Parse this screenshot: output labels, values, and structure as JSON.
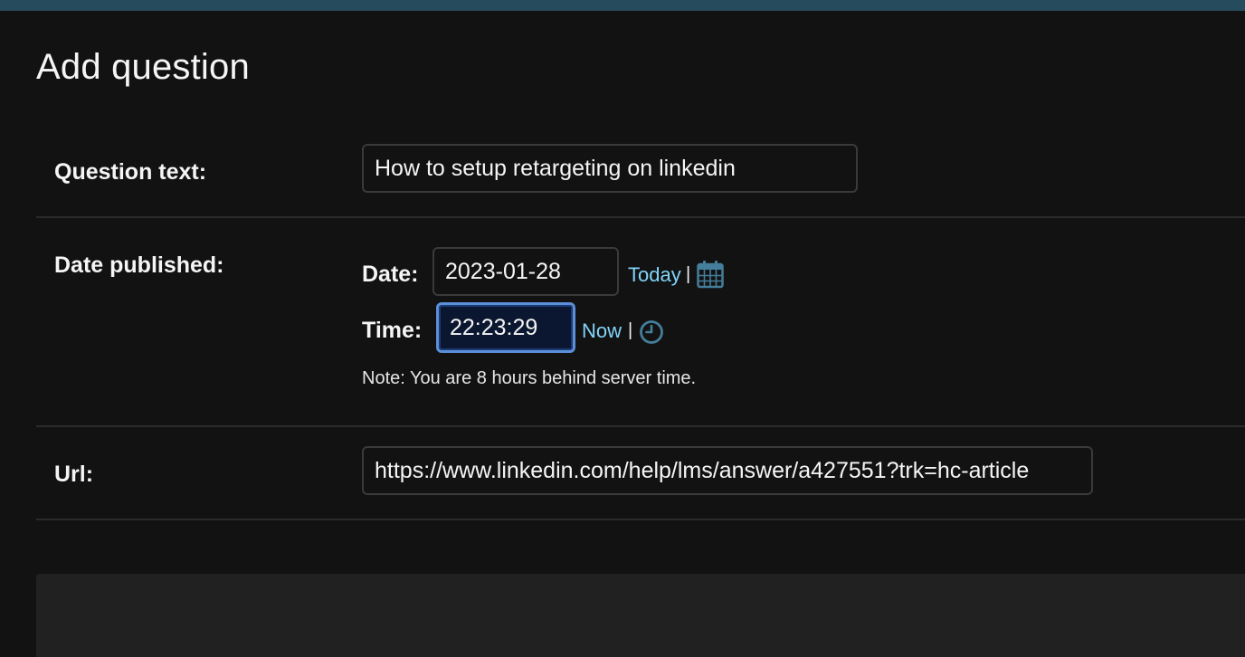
{
  "page": {
    "title": "Add question"
  },
  "fields": {
    "question_text": {
      "label": "Question text:",
      "value": "How to setup retargeting on linkedin"
    },
    "date_published": {
      "label": "Date published:",
      "date_label": "Date:",
      "date_value": "2023-01-28",
      "today_link": "Today",
      "separator": "|",
      "time_label": "Time:",
      "time_value": "22:23:29",
      "now_link": "Now",
      "note": "Note: You are 8 hours behind server time."
    },
    "url": {
      "label": "Url:",
      "value": "https://www.linkedin.com/help/lms/answer/a427551?trk=hc-article"
    }
  },
  "icons": {
    "calendar": "calendar-icon",
    "clock": "clock-icon"
  },
  "colors": {
    "accent": "#81d4fa",
    "header": "#264b5d",
    "background": "#121212",
    "focus": "#5b8fd8"
  }
}
